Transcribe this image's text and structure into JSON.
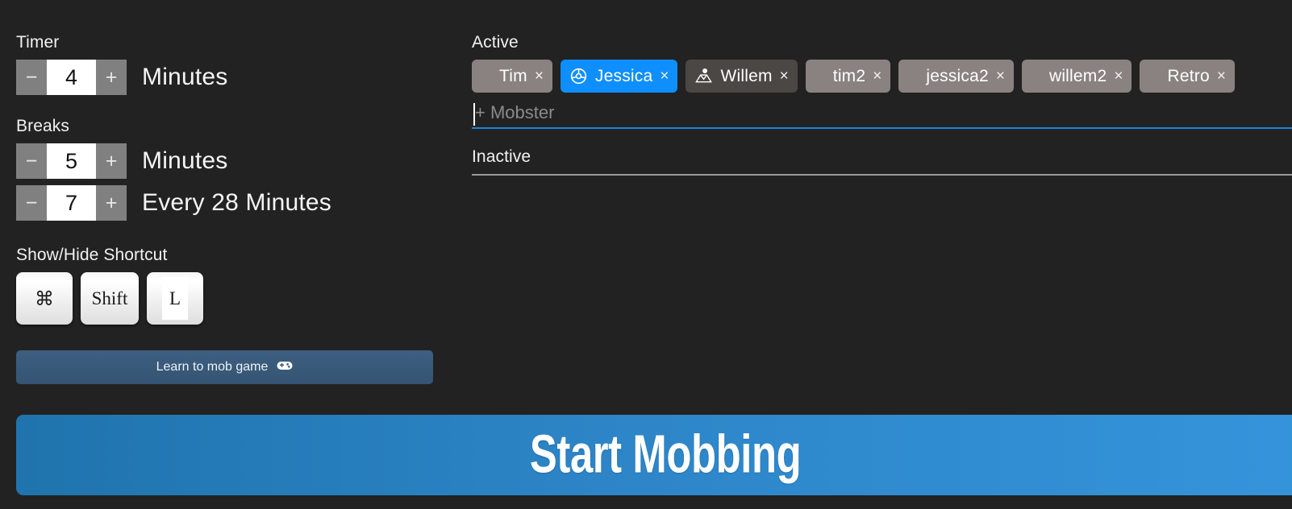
{
  "timer": {
    "label": "Timer",
    "decrement": "−",
    "increment": "+",
    "value": "4",
    "unit": "Minutes"
  },
  "breaks": {
    "label": "Breaks",
    "duration": {
      "decrement": "−",
      "increment": "+",
      "value": "5",
      "unit": "Minutes"
    },
    "interval": {
      "decrement": "−",
      "increment": "+",
      "value": "7",
      "unit": "Every 28 Minutes"
    }
  },
  "shortcut": {
    "label": "Show/Hide Shortcut",
    "keys": [
      {
        "name": "command-key",
        "label": "⌘",
        "editable": false
      },
      {
        "name": "shift-key",
        "label": "Shift",
        "editable": false
      },
      {
        "name": "letter-key",
        "label": "L",
        "editable": true
      }
    ]
  },
  "learn_button": {
    "label": "Learn to mob game",
    "icon": "gamepad-icon"
  },
  "active": {
    "label": "Active",
    "chips": [
      {
        "name": "Tim",
        "role": "none",
        "remove": "×"
      },
      {
        "name": "Jessica",
        "role": "driver",
        "remove": "×"
      },
      {
        "name": "Willem",
        "role": "navigator",
        "remove": "×"
      },
      {
        "name": "tim2",
        "role": "none",
        "remove": "×"
      },
      {
        "name": "jessica2",
        "role": "none",
        "remove": "×"
      },
      {
        "name": "willem2",
        "role": "none",
        "remove": "×"
      },
      {
        "name": "Retro",
        "role": "none",
        "remove": "×"
      }
    ],
    "input": {
      "value": "",
      "placeholder": "+ Mobster"
    }
  },
  "inactive": {
    "label": "Inactive",
    "chips": []
  },
  "start_button": {
    "label": "Start Mobbing"
  },
  "colors": {
    "background": "#222222",
    "accent_blue": "#0e8ffd",
    "chip_default": "#8a8280",
    "chip_navigator": "#4a4745",
    "start_button_from": "#1f74ad",
    "start_button_to": "#3494db",
    "learn_button": "#3d5f81",
    "stepper_button": "#808080",
    "input_underline": "#1b82d8",
    "inactive_rule": "#9a9a9a"
  }
}
